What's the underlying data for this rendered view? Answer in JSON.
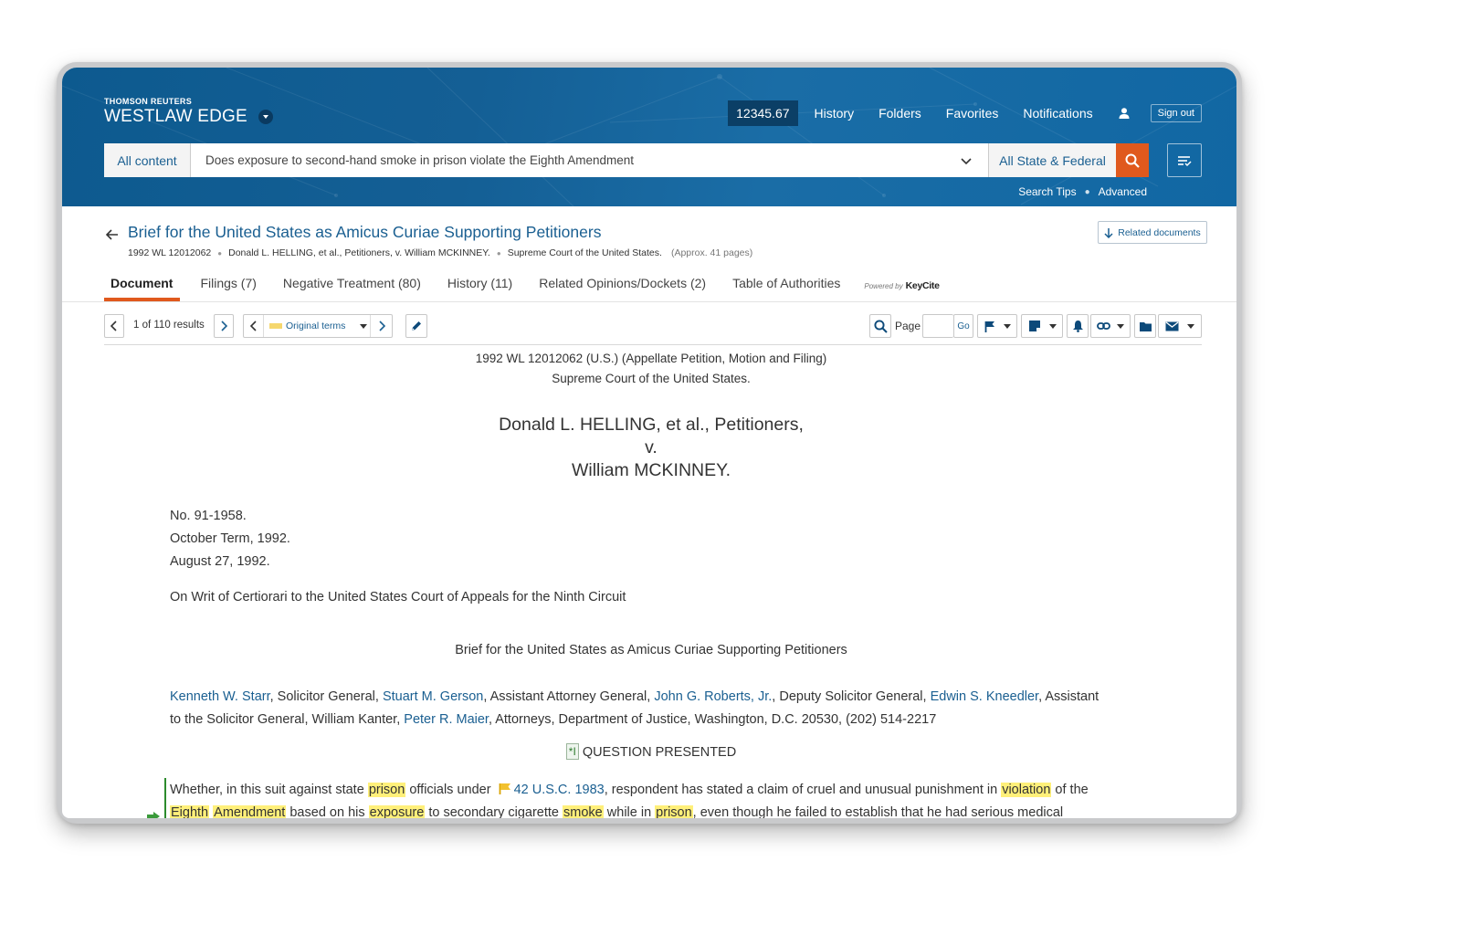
{
  "brand": {
    "company": "THOMSON REUTERS",
    "product": "WESTLAW EDGE"
  },
  "topnav": {
    "client_id": "12345.67",
    "links": [
      "History",
      "Folders",
      "Favorites",
      "Notifications"
    ],
    "sign_out": "Sign out"
  },
  "search": {
    "content_selector": "All content",
    "query": "Does exposure to second-hand smoke in prison violate the Eighth Amendment",
    "jurisdiction": "All State & Federal",
    "tips": "Search Tips",
    "advanced": "Advanced"
  },
  "document": {
    "title": "Brief for the United States as Amicus Curiae Supporting Petitioners",
    "citation": "1992 WL 12012062",
    "parties_short": "Donald L. HELLING, et al., Petitioners, v. William MCKINNEY.",
    "court": "Supreme Court of the United States.",
    "pages": "(Approx. 41 pages)",
    "related_button": "Related documents"
  },
  "tabs": [
    {
      "label": "Document",
      "active": true
    },
    {
      "label": "Filings (7)"
    },
    {
      "label": "Negative Treatment (80)"
    },
    {
      "label": "History (11)"
    },
    {
      "label": "Related Opinions/Dockets (2)"
    },
    {
      "label": "Table of Authorities"
    }
  ],
  "keycite": {
    "powered_by": "Powered by",
    "name": "KeyCite"
  },
  "toolbar": {
    "results": "1 of 110 results",
    "terms": "Original terms",
    "page_label": "Page",
    "go": "Go"
  },
  "body": {
    "header_line1": "1992 WL 12012062 (U.S.) (Appellate Petition, Motion and Filing)",
    "header_line2": "Supreme Court of the United States.",
    "caption_line1": "Donald L. HELLING, et al., Petitioners,",
    "caption_line2": "v.",
    "caption_line3": "William MCKINNEY.",
    "docket": "No. 91-1958.",
    "term": "October Term, 1992.",
    "date": "August 27, 1992.",
    "writ": "On Writ of Certiorari to the United States Court of Appeals for the Ninth Circuit",
    "brief_title": "Brief for the United States as Amicus Curiae Supporting Petitioners",
    "counsel": {
      "p1": "Kenneth W. Starr",
      "t1": ", Solicitor General, ",
      "p2": "Stuart M. Gerson",
      "t2": ", Assistant Attorney General, ",
      "p3": "John G. Roberts, Jr.",
      "t3": ", Deputy Solicitor General, ",
      "p4": "Edwin S. Kneedler",
      "t4": ", Assistant",
      "t5": "to the Solicitor General, William Kanter, ",
      "p5": "Peter R. Maier",
      "t6": ", Attorneys, Department of Justice, Washington, D.C. 20530, (202) 514-2217"
    },
    "star_page": "*I",
    "question_heading": "QUESTION PRESENTED",
    "q": {
      "a": "Whether, in this suit against state ",
      "h1": "prison",
      "b": " officials under ",
      "cite": "42 U.S.C. 1983",
      "c": ", respondent has stated a claim of cruel and unusual punishment in ",
      "h2": "violation",
      "d": " of the",
      "h3": "Eighth",
      "h4": "Amendment",
      "e": " based on his ",
      "h5": "exposure",
      "f": " to secondary cigarette ",
      "h6": "smoke",
      "g": " while in ",
      "h7": "prison",
      "h": ", even though he failed to establish that he had serious medical"
    }
  },
  "colors": {
    "header": "#145f95",
    "accent": "#e0591d",
    "link": "#1a5f91",
    "highlight": "#fff07a"
  }
}
